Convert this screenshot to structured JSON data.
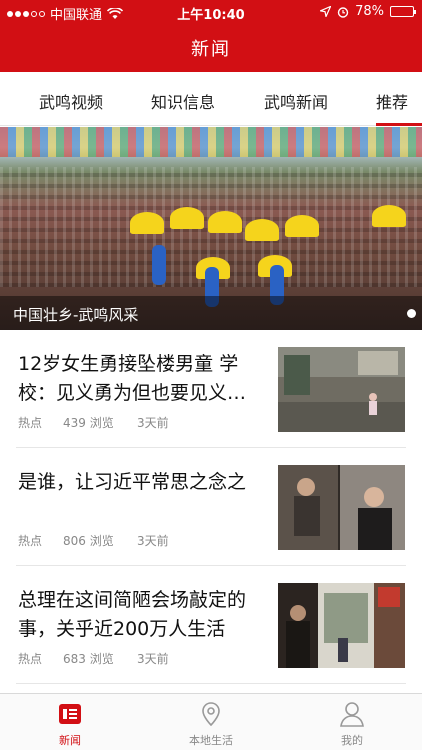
{
  "status_bar": {
    "carrier": "中国联通",
    "time": "上午10:40",
    "battery": "78%",
    "battery_level": 0.78,
    "icons": [
      "signal-dots-icon",
      "wifi-icon",
      "location-arrow-icon",
      "alarm-icon",
      "battery-icon"
    ]
  },
  "header": {
    "title": "新闻"
  },
  "tabs": [
    {
      "label": "武鸣视频"
    },
    {
      "label": "知识信息"
    },
    {
      "label": "武鸣新闻"
    },
    {
      "label": "推荐",
      "active": true
    }
  ],
  "banner": {
    "caption": "中国壮乡-武鸣风采"
  },
  "news": [
    {
      "title": "12岁女生勇接坠楼男童 学校：见义勇为但也要见义…",
      "tag": "热点",
      "views": "439 浏览",
      "time": "3天前"
    },
    {
      "title": "是谁，让习近平常思之念之",
      "tag": "热点",
      "views": "806 浏览",
      "time": "3天前"
    },
    {
      "title": "总理在这间简陋会场敲定的事，关乎近200万人生活",
      "tag": "热点",
      "views": "683 浏览",
      "time": "3天前"
    }
  ],
  "tabbar": [
    {
      "label": "新闻",
      "icon": "news-icon",
      "active": true
    },
    {
      "label": "本地生活",
      "icon": "location-pin-icon"
    },
    {
      "label": "我的",
      "icon": "person-icon"
    }
  ],
  "colors": {
    "brand_red": "#d20f14",
    "text_gray": "#888888"
  }
}
